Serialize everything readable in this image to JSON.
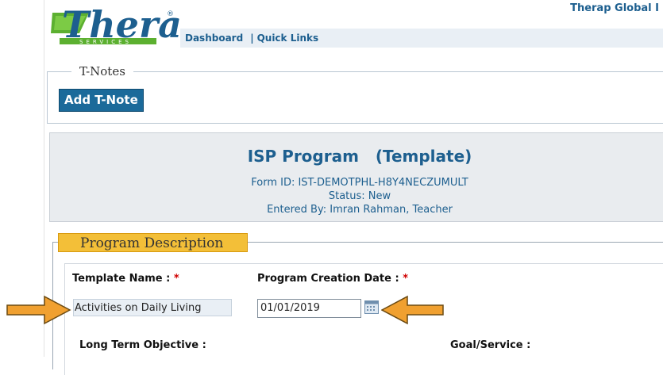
{
  "header": {
    "logo_text": "Therap",
    "logo_subtext": "SERVICES",
    "org_name": "Therap Global I",
    "nav": {
      "dashboard": "Dashboard",
      "separator": "|",
      "quick_links": "Quick Links"
    }
  },
  "tnotes": {
    "legend": "T-Notes",
    "add_button": "Add T-Note"
  },
  "form": {
    "title": "ISP Program   (Template)",
    "form_id": "Form ID: IST-DEMOTPHL-H8Y4NECZUMULT",
    "status": "Status: New",
    "entered_by": "Entered By: Imran Rahman, Teacher"
  },
  "program_description": {
    "legend": "Program Description",
    "template_name_label": "Template Name :",
    "template_name_value": "Activities on Daily Living",
    "creation_date_label": "Program Creation Date :",
    "creation_date_value": "01/01/2019",
    "required_marker": "*",
    "long_term_objective_label": "Long Term Objective :",
    "goal_service_label": "Goal/Service :"
  },
  "colors": {
    "brand_blue": "#1d5f8f",
    "logo_green": "#5cb030",
    "button_blue": "#1b6a9a",
    "legend_gold": "#f3bf38",
    "arrow_orange": "#f0a030",
    "required_red": "#d00000"
  },
  "icons": {
    "calendar": "calendar-icon",
    "arrows": "arrow-pointer-icon"
  }
}
